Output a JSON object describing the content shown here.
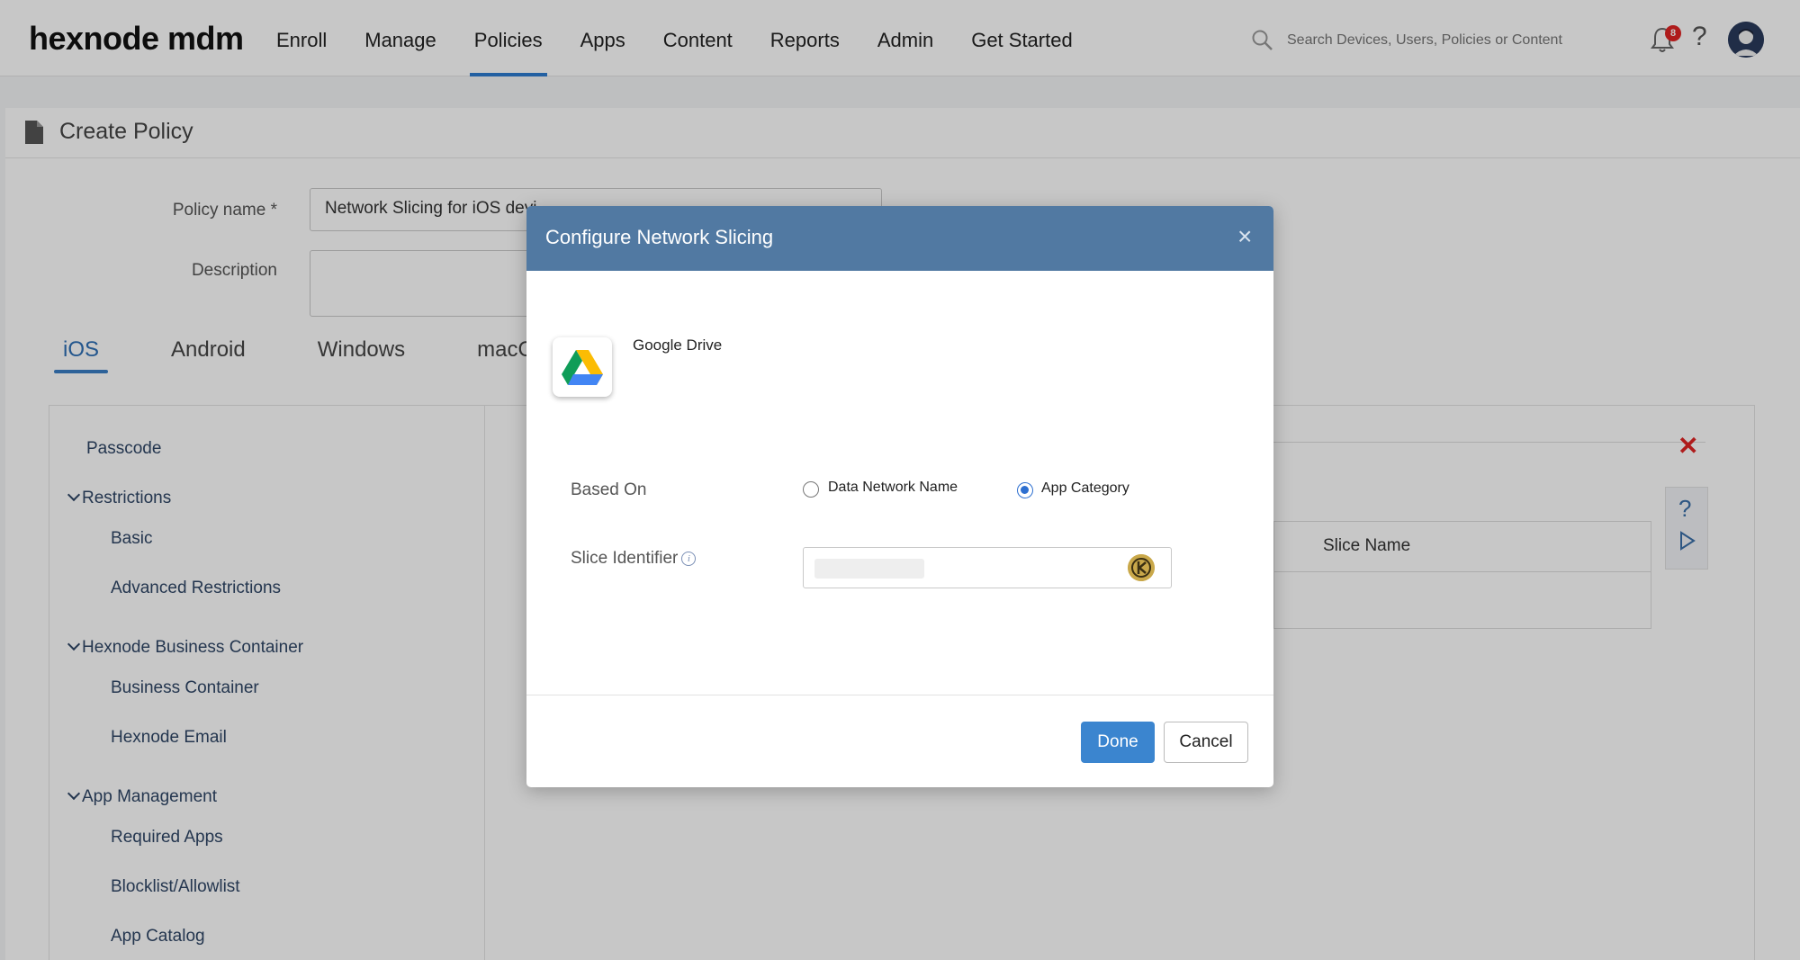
{
  "app": {
    "logo": "hexnode mdm"
  },
  "nav": {
    "items": [
      {
        "label": "Enroll"
      },
      {
        "label": "Manage"
      },
      {
        "label": "Policies"
      },
      {
        "label": "Apps"
      },
      {
        "label": "Content"
      },
      {
        "label": "Reports"
      },
      {
        "label": "Admin"
      },
      {
        "label": "Get Started"
      }
    ],
    "active": "Policies"
  },
  "search": {
    "placeholder": "Search Devices, Users, Policies or Content"
  },
  "notifications": {
    "count": "8"
  },
  "page": {
    "title": "Create Policy",
    "policy_name_label": "Policy name *",
    "policy_name_value": "Network Slicing for iOS devi",
    "description_label": "Description"
  },
  "tabs": [
    {
      "label": "iOS"
    },
    {
      "label": "Android"
    },
    {
      "label": "Windows"
    },
    {
      "label": "macOS"
    }
  ],
  "sidebar": {
    "passcode": "Passcode",
    "restrictions": "Restrictions",
    "basic": "Basic",
    "advanced_restrictions": "Advanced Restrictions",
    "business_container_group": "Hexnode Business Container",
    "business_container": "Business Container",
    "hexnode_email": "Hexnode Email",
    "app_management": "App Management",
    "required_apps": "Required Apps",
    "blocklist": "Blocklist/Allowlist",
    "app_catalog": "App Catalog"
  },
  "table": {
    "slice_name_header": "Slice Name"
  },
  "modal": {
    "title": "Configure Network Slicing",
    "app_name": "Google Drive",
    "based_on_label": "Based On",
    "option_dnn": "Data Network Name",
    "option_app_category": "App Category",
    "selected": "App Category",
    "slice_identifier_label": "Slice Identifier",
    "info_glyph": "i",
    "done": "Done",
    "cancel": "Cancel"
  },
  "colors": {
    "modal_header": "#5179a2",
    "primary_button": "#3b85cf",
    "accent": "#2d7bd0",
    "close_red": "#e02424"
  }
}
